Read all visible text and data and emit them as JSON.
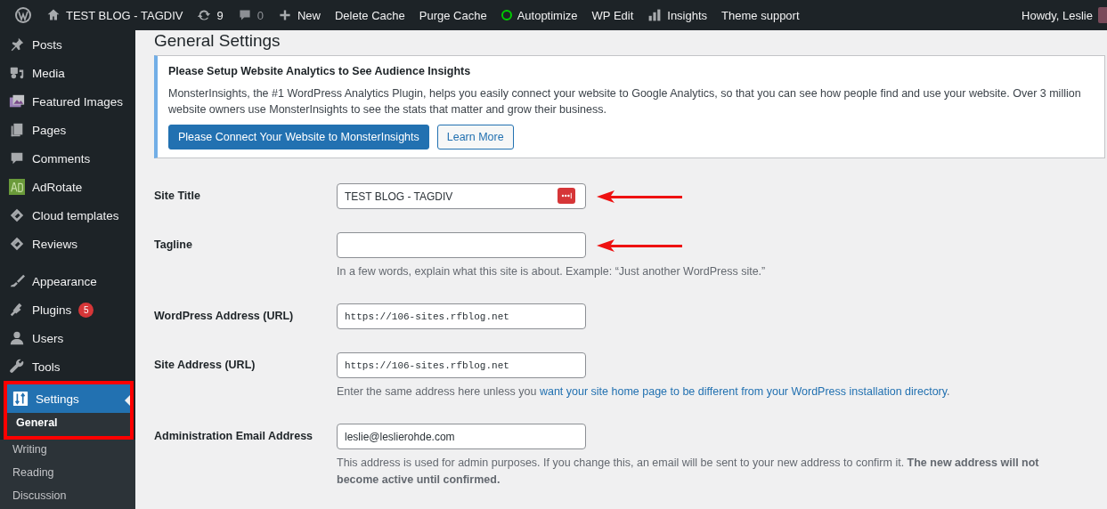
{
  "admin_bar": {
    "items": [
      {
        "kind": "wp-logo"
      },
      {
        "kind": "home",
        "label": "TEST BLOG - TAGDIV"
      },
      {
        "kind": "updates",
        "label": "9"
      },
      {
        "kind": "comments",
        "label": "0"
      },
      {
        "kind": "new",
        "label": "New"
      },
      {
        "kind": "text",
        "label": "Delete Cache"
      },
      {
        "kind": "text",
        "label": "Purge Cache"
      },
      {
        "kind": "status",
        "label": "Autoptimize",
        "color": "#00cc00"
      },
      {
        "kind": "text",
        "label": "WP Edit"
      },
      {
        "kind": "insights",
        "label": "Insights"
      },
      {
        "kind": "text",
        "label": "Theme support"
      }
    ],
    "greeting": "Howdy, Leslie"
  },
  "sidebar": {
    "items": [
      {
        "label": "Posts",
        "selected": false
      },
      {
        "label": "Media",
        "selected": false
      },
      {
        "label": "Featured Images",
        "selected": false
      },
      {
        "label": "Pages",
        "selected": false
      },
      {
        "label": "Comments",
        "selected": false
      },
      {
        "label": "AdRotate",
        "selected": false
      },
      {
        "label": "Cloud templates",
        "selected": false
      },
      {
        "label": "Reviews",
        "selected": false
      },
      {
        "label": "Appearance",
        "selected": false
      },
      {
        "label": "Plugins",
        "badge": "5",
        "selected": false
      },
      {
        "label": "Users",
        "selected": false
      },
      {
        "label": "Tools",
        "selected": false
      },
      {
        "label": "Settings",
        "selected": true,
        "highlighted": true,
        "children": [
          {
            "label": "General",
            "selected": true,
            "highlighted": true
          },
          {
            "label": "Writing",
            "selected": false,
            "highlighted": false
          },
          {
            "label": "Reading",
            "selected": false,
            "highlighted": false
          },
          {
            "label": "Discussion",
            "selected": false,
            "highlighted": false
          }
        ]
      }
    ]
  },
  "page": {
    "title": "General Settings",
    "notice": {
      "title": "Please Setup Website Analytics to See Audience Insights",
      "text": "MonsterInsights, the #1 WordPress Analytics Plugin, helps you easily connect your website to Google Analytics, so that you can see how people find and use your website. Over 3 million website owners use MonsterInsights to see the stats that matter and grow their business.",
      "buttons": [
        {
          "label": "Please Connect Your Website to MonsterInsights",
          "kind": "primary"
        },
        {
          "label": "Learn More",
          "kind": "secondary"
        }
      ]
    },
    "fields": [
      {
        "label": "Site Title",
        "value": "TEST BLOG - TAGDIV",
        "kind": "text",
        "password_icon": true,
        "highlighted": true
      },
      {
        "label": "Tagline",
        "kind": "text",
        "highlighted": true,
        "description": [
          {
            "kind": "text",
            "text": "In a few words, explain what this site is about. Example: “Just another WordPress site.”"
          }
        ]
      },
      {
        "label": "WordPress Address (URL)",
        "value": "https://106-sites.rfblog.net",
        "kind": "url",
        "highlighted": false
      },
      {
        "label": "Site Address (URL)",
        "value": "https://106-sites.rfblog.net",
        "kind": "url",
        "highlighted": false,
        "description": [
          {
            "kind": "text",
            "text": "Enter the same address here unless you "
          },
          {
            "kind": "link",
            "text": "want your site home page to be different from your WordPress installation directory"
          },
          {
            "kind": "text",
            "text": "."
          }
        ]
      },
      {
        "label": "Administration Email Address",
        "value": "leslie@leslierohde.com",
        "kind": "text",
        "highlighted": false,
        "description": [
          {
            "kind": "rich",
            "text": "This address is used for admin purposes. If you change this, an email will be sent to your new address to confirm it. **The new address will not become active until confirmed.**"
          }
        ]
      }
    ]
  }
}
